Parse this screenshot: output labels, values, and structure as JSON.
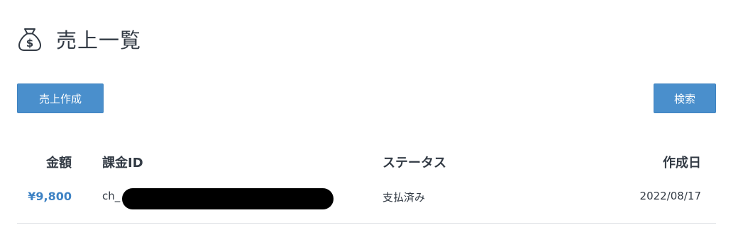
{
  "page": {
    "title": "売上一覧",
    "icon": "money-bag-icon"
  },
  "toolbar": {
    "create_label": "売上作成",
    "search_label": "検索"
  },
  "colors": {
    "primary_button": "#4a8fcc",
    "link": "#3d82c4",
    "text": "#333b45",
    "divider": "#dcdfe3"
  },
  "table": {
    "columns": [
      "金額",
      "課金ID",
      "ステータス",
      "作成日"
    ],
    "rows": [
      {
        "amount": "¥9,800",
        "charge_id": "ch_",
        "status": "支払済み",
        "created": "2022/08/17"
      }
    ]
  }
}
